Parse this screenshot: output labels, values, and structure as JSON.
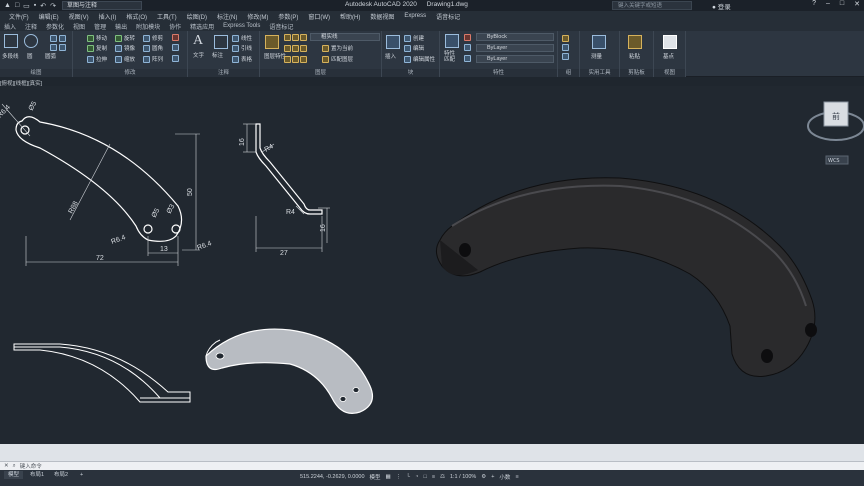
{
  "titlebar": {
    "workspace": "草图与注释",
    "app_title": "Autodesk AutoCAD 2020",
    "file_name": "Drawing1.dwg",
    "search_placeholder": "键入关键字或短语",
    "user_label": "登录"
  },
  "menu": [
    "文件(F)",
    "编辑(E)",
    "视图(V)",
    "插入(I)",
    "格式(O)",
    "工具(T)",
    "绘图(D)",
    "标注(N)",
    "修改(M)",
    "参数(P)",
    "窗口(W)",
    "帮助(H)",
    "数据视图",
    "Express",
    "语音标记"
  ],
  "ribbon_tabs": [
    "插入",
    "注释",
    "参数化",
    "视图",
    "管理",
    "输出",
    "附加模块",
    "协作",
    "精选应用",
    "Express Tools",
    "语音标记"
  ],
  "ribbon": {
    "draw": {
      "title": "绘图",
      "items": [
        "直线",
        "多段线",
        "圆",
        "圆弧"
      ]
    },
    "modify": {
      "title": "修改",
      "items": [
        "移动",
        "旋转",
        "修剪",
        "复制",
        "镜像",
        "圆角",
        "拉伸",
        "缩放",
        "阵列"
      ]
    },
    "annotation": {
      "title": "注释",
      "items": [
        "文字",
        "标注",
        "线性",
        "引线",
        "表格"
      ]
    },
    "layers": {
      "title": "图层",
      "combo": "粗实线",
      "items": [
        "图层特性",
        "置为当前",
        "匹配图层"
      ]
    },
    "block": {
      "title": "块",
      "items": [
        "插入",
        "创建",
        "编辑",
        "编辑属性"
      ]
    },
    "properties": {
      "title": "特性",
      "items": [
        "特性匹配"
      ],
      "combo1": "ByBlock",
      "combo2": "ByLayer",
      "combo3": "ByLayer"
    },
    "groups": {
      "title": "组"
    },
    "utilities": {
      "title": "实用工具",
      "items": [
        "测量"
      ]
    },
    "clipboard": {
      "title": "剪贴板",
      "items": [
        "粘贴"
      ]
    },
    "view": {
      "title": "视图",
      "items": [
        "基点"
      ]
    }
  },
  "viewport_label": "[俯视][线框][真实]",
  "drawing": {
    "front_dims": {
      "r1": "R6.4",
      "d1": "Ø5",
      "r2": "R88",
      "d2": "Ø5",
      "d3": "Ø3",
      "r3": "R6.4",
      "r4": "R6.4",
      "w1": "13",
      "w2": "72",
      "h1": "50"
    },
    "side_dims": {
      "h1": "16",
      "r1": "R4",
      "r2": "R4",
      "h2": "16",
      "w1": "27"
    },
    "viewcube": {
      "face": "前",
      "top_label": "上",
      "wcs": "WCS"
    }
  },
  "command": {
    "prompt_placeholder": "键入命令"
  },
  "layouts": [
    "模型",
    "布局1",
    "布局2"
  ],
  "status": {
    "coords": "515.2244, -0.2629, 0.0000",
    "mode": "模型",
    "scale": "1:1 / 100%",
    "units": "小数"
  }
}
